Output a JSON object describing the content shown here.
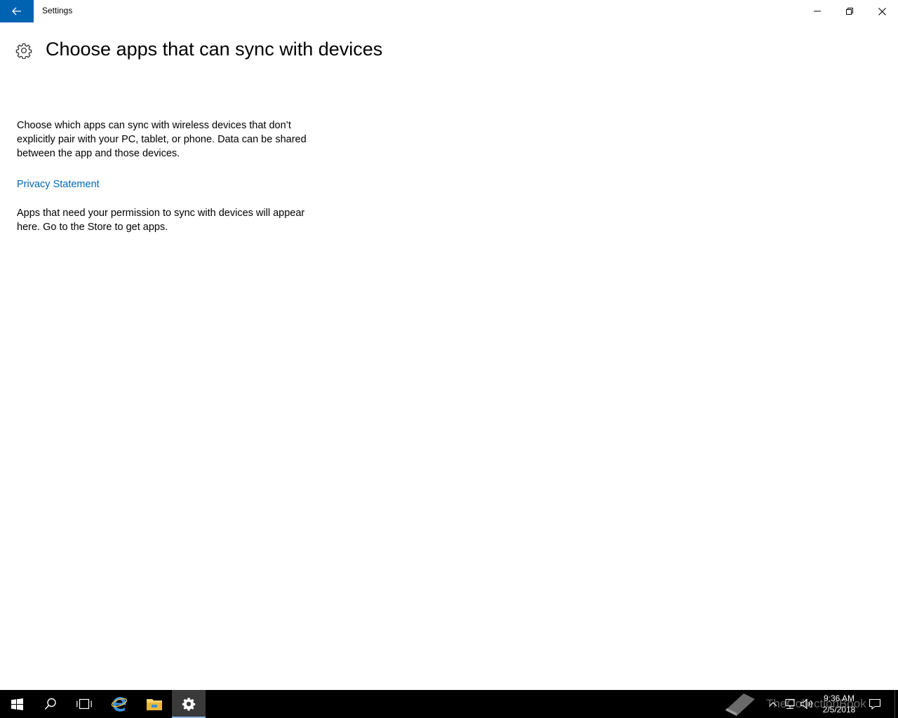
{
  "window": {
    "app_title": "Settings",
    "back_icon": "back-arrow-icon",
    "controls": [
      "minimize-icon",
      "restore-icon",
      "close-icon"
    ]
  },
  "header": {
    "icon": "gear-icon",
    "title": "Choose apps that can sync with devices"
  },
  "content": {
    "description": "Choose which apps can sync with wireless devices that don’t explicitly pair with your PC, tablet, or phone. Data can be shared between the app and those devices.",
    "privacy_link": "Privacy Statement",
    "empty_message": "Apps that need your permission to sync with devices will appear here. Go to the Store to get apps."
  },
  "taskbar": {
    "apps": [
      "windows-start-icon",
      "search-icon",
      "task-view-icon",
      "edge-icon",
      "file-explorer-icon",
      "settings-icon"
    ],
    "active_app": "settings-icon",
    "watermark": "TheCollectionBook",
    "tray": [
      "chevron-up-icon",
      "network-icon",
      "volume-icon"
    ],
    "clock": {
      "time": "9:36 AM",
      "date": "2/5/2018"
    },
    "notification_icon": "action-center-icon"
  },
  "colors": {
    "accent": "#0063b1",
    "link": "#0067b8",
    "taskbar": "#000000"
  }
}
